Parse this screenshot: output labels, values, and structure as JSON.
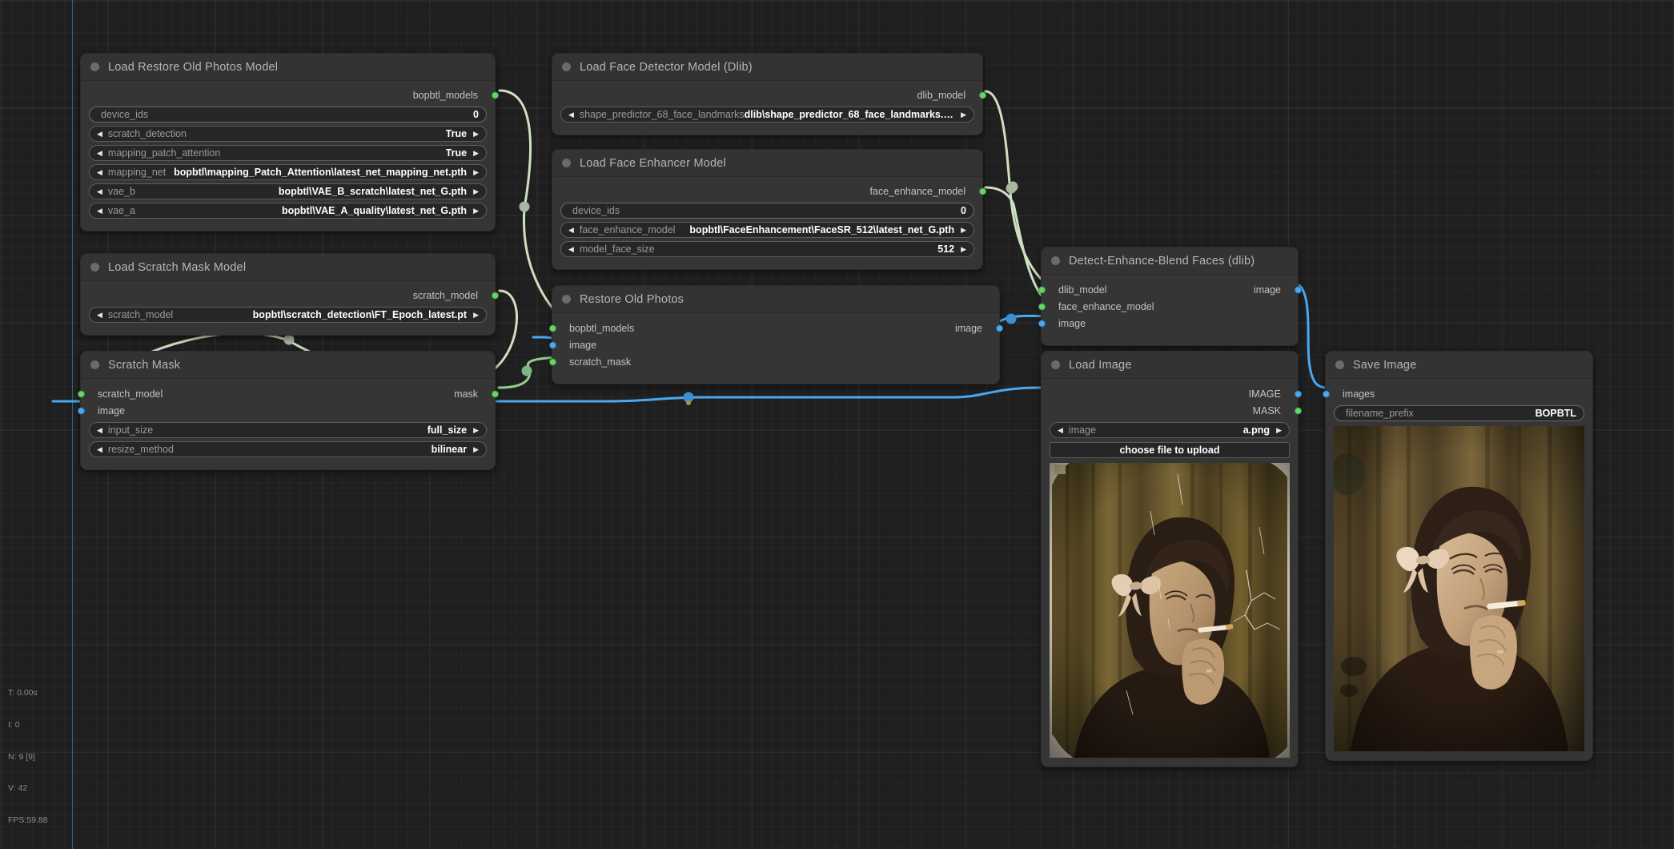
{
  "app": {
    "canvas_name": "node-graph-canvas",
    "accent_green": "#63d863",
    "accent_blue": "#4ba8f0",
    "node_bg": "#353535",
    "link_green": "#cfe0c0",
    "link_blue": "#4ba8f0"
  },
  "stats": {
    "time": "T: 0.00s",
    "iterations": "I: 0",
    "nodes": "N: 9 [9]",
    "vertices": "V: 42",
    "fps": "FPS:59.88"
  },
  "nodes": [
    {
      "id": "load-restore-old-photos-model",
      "title": "Load Restore Old Photos Model",
      "outputs": [
        {
          "label": "bopbtl_models",
          "type": "green"
        }
      ],
      "inputs": [],
      "widgets": [
        {
          "name": "device_ids",
          "value": "0",
          "kind": "plain"
        },
        {
          "name": "scratch_detection",
          "value": "True",
          "kind": "combo"
        },
        {
          "name": "mapping_patch_attention",
          "value": "True",
          "kind": "combo"
        },
        {
          "name": "mapping_net",
          "value": "bopbtl\\mapping_Patch_Attention\\latest_net_mapping_net.pth",
          "kind": "combo"
        },
        {
          "name": "vae_b",
          "value": "bopbtl\\VAE_B_scratch\\latest_net_G.pth",
          "kind": "combo"
        },
        {
          "name": "vae_a",
          "value": "bopbtl\\VAE_A_quality\\latest_net_G.pth",
          "kind": "combo"
        }
      ]
    },
    {
      "id": "load-face-detector-model-dlib",
      "title": "Load Face Detector Model (Dlib)",
      "outputs": [
        {
          "label": "dlib_model",
          "type": "green"
        }
      ],
      "inputs": [],
      "widgets": [
        {
          "name": "shape_predictor_68_face_landmarks",
          "value": "dlib\\shape_predictor_68_face_landmarks.dat",
          "kind": "combo"
        }
      ]
    },
    {
      "id": "load-face-enhancer-model",
      "title": "Load Face Enhancer Model",
      "outputs": [
        {
          "label": "face_enhance_model",
          "type": "green"
        }
      ],
      "inputs": [],
      "widgets": [
        {
          "name": "device_ids",
          "value": "0",
          "kind": "plain"
        },
        {
          "name": "face_enhance_model",
          "value": "bopbtl\\FaceEnhancement\\FaceSR_512\\latest_net_G.pth",
          "kind": "combo"
        },
        {
          "name": "model_face_size",
          "value": "512",
          "kind": "combo"
        }
      ]
    },
    {
      "id": "load-scratch-mask-model",
      "title": "Load Scratch Mask Model",
      "outputs": [
        {
          "label": "scratch_model",
          "type": "green"
        }
      ],
      "inputs": [],
      "widgets": [
        {
          "name": "scratch_model",
          "value": "bopbtl\\scratch_detection\\FT_Epoch_latest.pt",
          "kind": "combo"
        }
      ]
    },
    {
      "id": "restore-old-photos",
      "title": "Restore Old Photos",
      "outputs": [
        {
          "label": "image",
          "type": "blue"
        }
      ],
      "inputs": [
        {
          "label": "bopbtl_models",
          "type": "green"
        },
        {
          "label": "image",
          "type": "blue"
        },
        {
          "label": "scratch_mask",
          "type": "green"
        }
      ],
      "widgets": []
    },
    {
      "id": "scratch-mask",
      "title": "Scratch Mask",
      "outputs": [
        {
          "label": "mask",
          "type": "green"
        }
      ],
      "inputs": [
        {
          "label": "scratch_model",
          "type": "green"
        },
        {
          "label": "image",
          "type": "blue"
        }
      ],
      "widgets": [
        {
          "name": "input_size",
          "value": "full_size",
          "kind": "combo"
        },
        {
          "name": "resize_method",
          "value": "bilinear",
          "kind": "combo"
        }
      ]
    },
    {
      "id": "detect-enhance-blend-faces-dlib",
      "title": "Detect-Enhance-Blend Faces (dlib)",
      "outputs": [
        {
          "label": "image",
          "type": "blue"
        }
      ],
      "inputs": [
        {
          "label": "dlib_model",
          "type": "green"
        },
        {
          "label": "face_enhance_model",
          "type": "green"
        },
        {
          "label": "image",
          "type": "blue"
        }
      ],
      "widgets": []
    },
    {
      "id": "load-image",
      "title": "Load Image",
      "outputs": [
        {
          "label": "IMAGE",
          "type": "blue"
        },
        {
          "label": "MASK",
          "type": "green"
        }
      ],
      "inputs": [],
      "widgets": [
        {
          "name": "image",
          "value": "a.png",
          "kind": "combo"
        }
      ],
      "button": "choose file to upload",
      "preview": "vintage-sepia-portrait-original"
    },
    {
      "id": "save-image",
      "title": "Save Image",
      "outputs": [],
      "inputs": [
        {
          "label": "images",
          "type": "blue"
        }
      ],
      "widgets": [
        {
          "name": "filename_prefix",
          "value": "BOPBTL",
          "kind": "plain"
        }
      ],
      "preview": "vintage-sepia-portrait-restored"
    }
  ]
}
